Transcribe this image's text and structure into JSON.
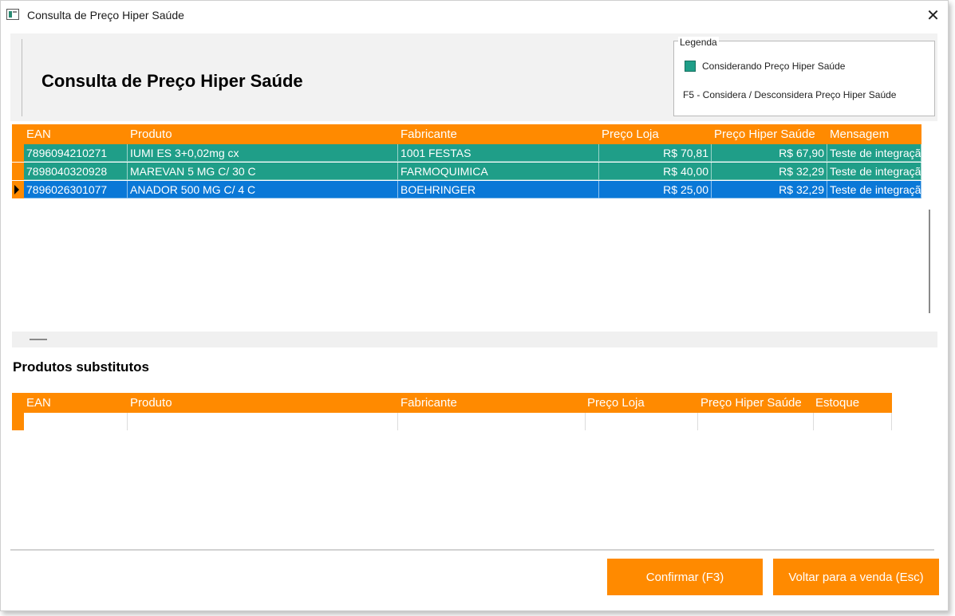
{
  "window": {
    "title": "Consulta de Preço Hiper Saúde",
    "close_symbol": "✕"
  },
  "header": {
    "page_title": "Consulta de Preço Hiper Saúde"
  },
  "legend": {
    "title": "Legenda",
    "item_label": "Considerando Preço Hiper Saúde",
    "item_color": "#1f9e88",
    "shortcut_text": "F5 - Considera / Desconsidera Preço Hiper Saúde"
  },
  "main_grid": {
    "columns": [
      "EAN",
      "Produto",
      "Fabricante",
      "Preço Loja",
      "Preço Hiper Saúde",
      "Mensagem"
    ],
    "rows": [
      {
        "ean": "7896094210271",
        "produto": "IUMI ES 3+0,02mg cx",
        "fabricante": "1001 FESTAS",
        "preco_loja": "R$ 70,81",
        "preco_hiper": "R$ 67,90",
        "mensagem": "Teste de integração"
      },
      {
        "ean": "7898040320928",
        "produto": "MAREVAN 5 MG C/ 30 C",
        "fabricante": "FARMOQUIMICA",
        "preco_loja": "R$ 40,00",
        "preco_hiper": "R$ 32,29",
        "mensagem": "Teste de integração"
      },
      {
        "ean": "7896026301077",
        "produto": "ANADOR 500 MG C/ 4 C",
        "fabricante": "BOEHRINGER",
        "preco_loja": "R$ 25,00",
        "preco_hiper": "R$ 32,29",
        "mensagem": "Teste de integração"
      }
    ],
    "colors": {
      "header": "#ff8a00",
      "highlight": "#1f9e88",
      "selected": "#0a78d7"
    }
  },
  "substitutes": {
    "title": "Produtos substitutos",
    "columns": [
      "EAN",
      "Produto",
      "Fabricante",
      "Preço Loja",
      "Preço Hiper Saúde",
      "Estoque"
    ]
  },
  "buttons": {
    "confirm": "Confirmar (F3)",
    "back": "Voltar para a venda (Esc)"
  }
}
